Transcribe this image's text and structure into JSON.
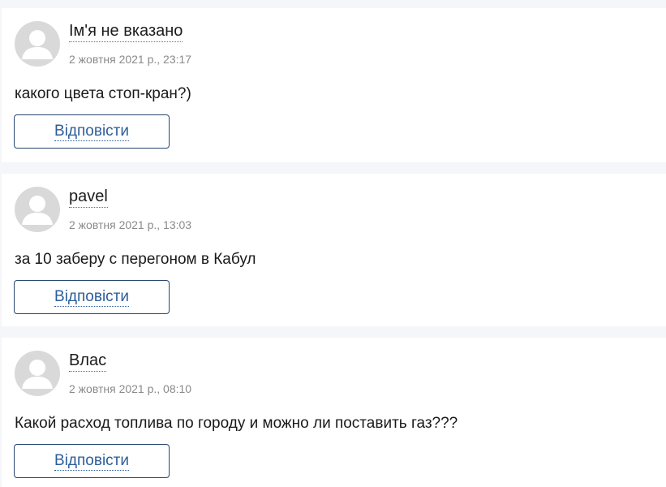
{
  "comments": [
    {
      "author": "Ім'я не вказано",
      "date": "2 жовтня 2021 р., 23:17",
      "text": "какого цвета стоп-кран?)",
      "reply_label": "Відповісти"
    },
    {
      "author": "pavel",
      "date": "2 жовтня 2021 р., 13:03",
      "text": "за 10 заберу с перегоном в Кабул",
      "reply_label": "Відповісти"
    },
    {
      "author": "Влас",
      "date": "2 жовтня 2021 р., 08:10",
      "text": "Какой расход топлива по городу и можно ли поставить газ???",
      "reply_label": "Відповісти"
    }
  ],
  "icons": {
    "avatar": "user-avatar-placeholder-icon"
  },
  "colors": {
    "page_background": "#f4f6fa",
    "card_background": "#ffffff",
    "reply_border": "#27466e",
    "reply_text": "#2c5d9a",
    "date_text": "#8a8a8a",
    "avatar": "#d9d9d9"
  }
}
